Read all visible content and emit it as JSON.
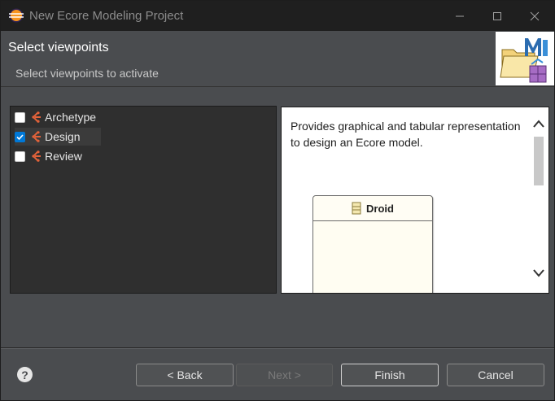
{
  "window": {
    "title": "New Ecore Modeling Project"
  },
  "header": {
    "title": "Select viewpoints",
    "subtitle": "Select viewpoints to activate"
  },
  "viewpoints": [
    {
      "label": "Archetype",
      "checked": false
    },
    {
      "label": "Design",
      "checked": true
    },
    {
      "label": "Review",
      "checked": false
    }
  ],
  "description": {
    "text": "Provides graphical and tabular representation to design an Ecore model.",
    "preview_class": "Droid"
  },
  "buttons": {
    "back": "< Back",
    "next": "Next >",
    "finish": "Finish",
    "cancel": "Cancel"
  },
  "icons": {
    "help": "help-icon",
    "viewpoint": "viewpoint-icon"
  },
  "colors": {
    "accent": "#0078d7",
    "viewpoint_icon": "#e2623a"
  }
}
